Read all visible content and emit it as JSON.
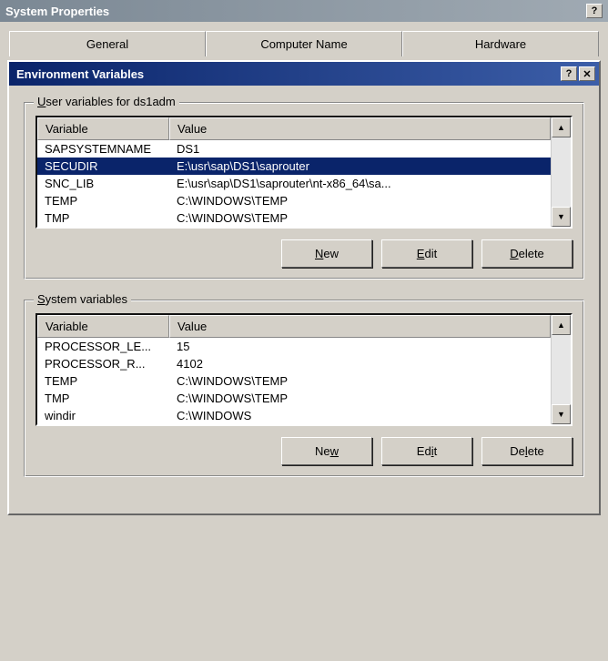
{
  "window": {
    "title": "System Properties"
  },
  "tabs": {
    "general": "General",
    "computer_name": "Computer Name",
    "hardware": "Hardware"
  },
  "dialog": {
    "title": "Environment Variables"
  },
  "user_vars": {
    "group_label_pre": "U",
    "group_label_rest": "ser variables for ds1adm",
    "header_variable": "Variable",
    "header_value": "Value",
    "rows": [
      {
        "variable": "SAPSYSTEMNAME",
        "value": "DS1"
      },
      {
        "variable": "SECUDIR",
        "value": "E:\\usr\\sap\\DS1\\saprouter"
      },
      {
        "variable": "SNC_LIB",
        "value": "E:\\usr\\sap\\DS1\\saprouter\\nt-x86_64\\sa..."
      },
      {
        "variable": "TEMP",
        "value": "C:\\WINDOWS\\TEMP"
      },
      {
        "variable": "TMP",
        "value": "C:\\WINDOWS\\TEMP"
      }
    ],
    "selected_index": 1,
    "buttons": {
      "new_pre": "N",
      "new_rest": "ew",
      "edit_pre": "E",
      "edit_rest": "dit",
      "delete_pre": "D",
      "delete_rest": "elete"
    }
  },
  "sys_vars": {
    "group_label_pre": "S",
    "group_label_rest": "ystem variables",
    "header_variable": "Variable",
    "header_value": "Value",
    "rows": [
      {
        "variable": "PROCESSOR_LE...",
        "value": "15"
      },
      {
        "variable": "PROCESSOR_R...",
        "value": "4102"
      },
      {
        "variable": "TEMP",
        "value": "C:\\WINDOWS\\TEMP"
      },
      {
        "variable": "TMP",
        "value": "C:\\WINDOWS\\TEMP"
      },
      {
        "variable": "windir",
        "value": "C:\\WINDOWS"
      }
    ],
    "buttons": {
      "new_pre": "Ne",
      "new_ul": "w",
      "new_rest": "",
      "edit_pre": "Ed",
      "edit_ul": "i",
      "edit_rest": "t",
      "delete_pre": "De",
      "delete_ul": "l",
      "delete_rest": "ete"
    }
  },
  "icons": {
    "help": "?",
    "close": "✕",
    "up": "▲",
    "down": "▼"
  }
}
